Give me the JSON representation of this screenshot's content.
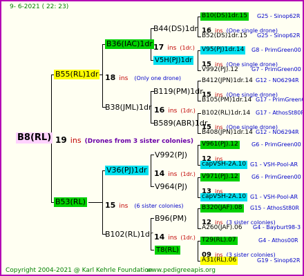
{
  "header": {
    "date": "9-  6-2021 ( 22: 23)"
  },
  "root": {
    "name": "B8(RL)",
    "ins": "19",
    "ins_label": "ins",
    "desc": "(Drones from 3 sister colonies)"
  },
  "gen1": [
    {
      "name": "B55(RL)1dr",
      "ins": "18",
      "ins_label": "ins",
      "desc": "(Only one drone)"
    },
    {
      "name": "B53(RL)",
      "ins": "15",
      "ins_label": "ins",
      "desc": "(6 sister colonies)"
    }
  ],
  "gen2": [
    {
      "name": "B36(IAC)1dr",
      "ins": "17",
      "ins_label": "ins",
      "desc": "(1dr.)"
    },
    {
      "name": "B38(JML)1dr",
      "ins": "16",
      "ins_label": "ins",
      "desc": "(1dr.)"
    },
    {
      "name": "V36(PJ)1dr",
      "ins": "14",
      "ins_label": "ins",
      "desc": "(1dr.)"
    },
    {
      "name": "B102(RL)1dr",
      "ins": "14",
      "ins_label": "ins",
      "desc": "(1dr.)"
    }
  ],
  "gen3": [
    {
      "name": "B44(DS)1dr",
      "ins": "",
      "ins_label": "",
      "desc": ""
    },
    {
      "name": "V5H(PJ)1dr",
      "ins": "15",
      "ins_label": "ins",
      "desc": "(1dr.)"
    },
    {
      "name": "B119(PM)1dr",
      "ins": "",
      "ins_label": "",
      "desc": ""
    },
    {
      "name": "B589(ABR)1dr",
      "ins": "15",
      "ins_label": "ins",
      "desc": "(1dr.)"
    },
    {
      "name": "V992(PJ)",
      "ins": "",
      "ins_label": "",
      "desc": ""
    },
    {
      "name": "V964(PJ)",
      "ins": "",
      "ins_label": "",
      "desc": ""
    },
    {
      "name": "B96(PM)",
      "ins": "",
      "ins_label": "",
      "desc": ""
    },
    {
      "name": "T8(RL)",
      "ins": "",
      "ins_label": "",
      "desc": ""
    }
  ],
  "gen3_extra": [
    {
      "ins": "17",
      "ins_label": "ins",
      "desc": "(1dr.)"
    },
    {
      "ins": "16",
      "ins_label": "ins",
      "desc": "(1dr.)"
    },
    {
      "ins": "14",
      "ins_label": "ins",
      "desc": "(1dr.)"
    },
    {
      "ins": "14",
      "ins_label": "ins",
      "desc": "(1dr.)"
    }
  ],
  "right": [
    {
      "name": "B10(DS)1dr.15",
      "code": "G25 - Sinop62R"
    },
    {
      "count": "16",
      "ins_label": "ins",
      "desc": "(One single drone)"
    },
    {
      "name": "B52(DS)1dr.15",
      "code": "G25 - Sinop62R"
    },
    {
      "name": "V95(PJ)1dr.14",
      "code": "G8 - PrimGreen00"
    },
    {
      "count": "15",
      "ins_label": "ins",
      "desc": "(One single drone)"
    },
    {
      "name": "V992(PJ).12",
      "code": "G7 - PrimGreen00"
    },
    {
      "name": "B412(JPN)1dr.14",
      "code": "G12 - NO6294R"
    },
    {
      "count": "15",
      "ins_label": "ins",
      "desc": "(One single drone)"
    },
    {
      "name": "B105(PM)1dr.14",
      "code": "G17 - PrimGreen00"
    },
    {
      "name": "B102(RL)1dr.14",
      "code": "G17 - AthosSt80R"
    },
    {
      "count": "15",
      "ins_label": "ins",
      "desc": "(One single drone)"
    },
    {
      "name": "B408(JPN)1dr.14",
      "code": "G12 - NO6294R"
    },
    {
      "name": "V961(PJ).12",
      "code": "G6 - PrimGreen00"
    },
    {
      "count": "12",
      "ins_label": "ins",
      "desc": ""
    },
    {
      "name": "capVSH-2A.10",
      "code": "G1 - VSH-Pool-AR"
    },
    {
      "name": "V971(PJ).12",
      "code": "G6 - PrimGreen00"
    },
    {
      "count": "13",
      "ins_label": "ins",
      "desc": ""
    },
    {
      "name": "capVSH-2A.10",
      "code": "G1 - VSH-Pool-AR"
    },
    {
      "name": "B320(JAF).08",
      "code": "G15 - AthosSt80R"
    },
    {
      "count": "12",
      "ins_label": "ins",
      "desc": "(3 sister colonies)"
    },
    {
      "name": "A260(JAF).06",
      "code": "G4 - Bayburt98-3"
    },
    {
      "name": "T29(RL).07",
      "code": "G4 - Athos00R"
    },
    {
      "count": "09",
      "ins_label": "ins",
      "desc": "(3 sister colonies)"
    },
    {
      "name": "A31(RL).06",
      "code": "G19 - Sinop62R"
    }
  ],
  "footer": {
    "copyright": "Copyright 2004-2021 @ Karl Kehrle Foundation",
    "url": "www.pedigreeapis.org"
  }
}
